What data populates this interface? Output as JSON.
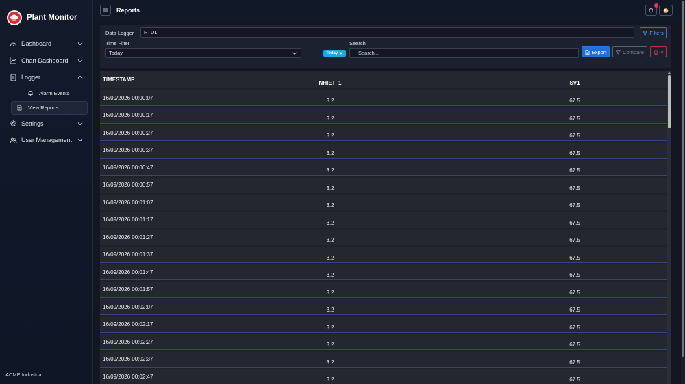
{
  "brand": {
    "title": "Plant Monitor",
    "logo_icon": "cloud-shield-icon",
    "accent": "#d9302f"
  },
  "sidebar": {
    "items": [
      {
        "label": "Dashboard",
        "icon": "gauge-icon",
        "expanded": false
      },
      {
        "label": "Chart Dashboard",
        "icon": "line-chart-icon",
        "expanded": false
      },
      {
        "label": "Logger",
        "icon": "document-icon",
        "expanded": true,
        "children": [
          {
            "label": "Alarm Events",
            "icon": "bell-icon",
            "active": false
          },
          {
            "label": "View Reports",
            "icon": "file-icon",
            "active": true
          }
        ]
      },
      {
        "label": "Settings",
        "icon": "gear-icon",
        "expanded": false
      },
      {
        "label": "User Management",
        "icon": "users-icon",
        "expanded": false
      }
    ],
    "footer": "ACME Industrial"
  },
  "topbar": {
    "title": "Reports",
    "notification_dot_color": "#e53945"
  },
  "filters": {
    "data_logger_label": "Data Logger",
    "data_logger_value": "RTU1",
    "filters_button": "Filters",
    "time_filter_label": "Time Filter",
    "time_filter_value": "Today",
    "badge_label": "Today",
    "search_label": "Search",
    "search_placeholder": "Search...",
    "export_button": "Export",
    "compare_button": "Compare"
  },
  "table": {
    "columns": [
      "TIMESTAMP",
      "NHIET_1",
      "SV1"
    ],
    "rows": [
      [
        "16/09/2026 00:00:07",
        "3.2",
        "67.5"
      ],
      [
        "16/09/2026 00:00:17",
        "3.2",
        "67.5"
      ],
      [
        "16/09/2026 00:00:27",
        "3.2",
        "67.5"
      ],
      [
        "16/09/2026 00:00:37",
        "3.2",
        "67.5"
      ],
      [
        "16/09/2026 00:00:47",
        "3.2",
        "67.5"
      ],
      [
        "16/09/2026 00:00:57",
        "3.2",
        "67.5"
      ],
      [
        "16/09/2026 00:01:07",
        "3.2",
        "67.5"
      ],
      [
        "16/09/2026 00:01:17",
        "3.2",
        "67.5"
      ],
      [
        "16/09/2026 00:01:27",
        "3.2",
        "67.5"
      ],
      [
        "16/09/2026 00:01:37",
        "3.2",
        "67.5"
      ],
      [
        "16/09/2026 00:01:47",
        "3.2",
        "67.5"
      ],
      [
        "16/09/2026 00:01:57",
        "3.2",
        "67.5"
      ],
      [
        "16/09/2026 00:02:07",
        "3.2",
        "67.5"
      ],
      [
        "16/09/2026 00:02:17",
        "3.2",
        "67.5"
      ],
      [
        "16/09/2026 00:02:27",
        "3.2",
        "67.5"
      ],
      [
        "16/09/2026 00:02:37",
        "3.2",
        "67.5"
      ],
      [
        "16/09/2026 00:02:47",
        "3.2",
        "67.5"
      ]
    ]
  }
}
